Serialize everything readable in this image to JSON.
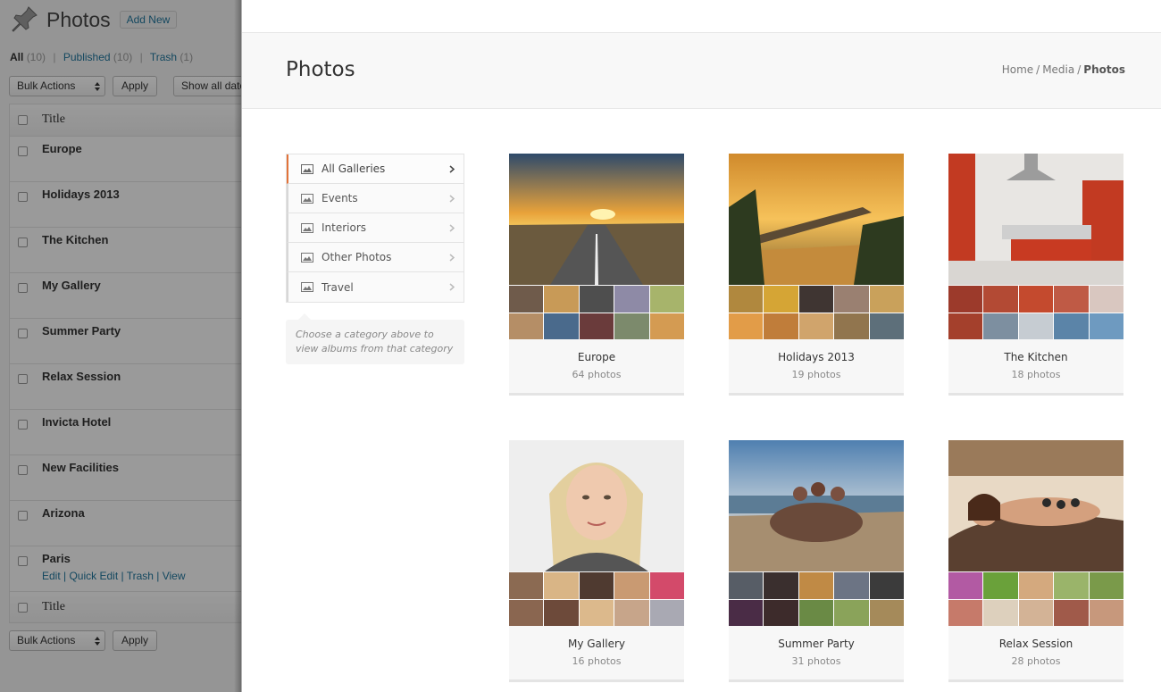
{
  "admin": {
    "title": "Photos",
    "add_new": "Add New",
    "filter": {
      "all_label": "All",
      "all_count": "(10)",
      "published_label": "Published",
      "published_count": "(10)",
      "trash_label": "Trash",
      "trash_count": "(1)"
    },
    "bulk_actions": "Bulk Actions",
    "apply": "Apply",
    "show_all": "Show all dates",
    "column_title": "Title",
    "items": [
      "Europe",
      "Holidays 2013",
      "The Kitchen",
      "My Gallery",
      "Summer Party",
      "Relax Session",
      "Invicta Hotel",
      "New Facilities",
      "Arizona",
      "Paris"
    ],
    "row_actions": "Edit | Quick Edit | Trash | View"
  },
  "page": {
    "title": "Photos",
    "breadcrumb": {
      "home": "Home",
      "media": "Media",
      "current": "Photos",
      "separator": "/"
    }
  },
  "categories": {
    "items": [
      "All Galleries",
      "Events",
      "Interiors",
      "Other Photos",
      "Travel"
    ],
    "note": "Choose a category above to view albums from that category"
  },
  "albums": [
    {
      "name": "Europe",
      "count": "64 photos"
    },
    {
      "name": "Holidays 2013",
      "count": "19 photos"
    },
    {
      "name": "The Kitchen",
      "count": "18 photos"
    },
    {
      "name": "My Gallery",
      "count": "16 photos"
    },
    {
      "name": "Summer Party",
      "count": "31 photos"
    },
    {
      "name": "Relax Session",
      "count": "28 photos"
    }
  ],
  "colors": {
    "accent": "#e2733a",
    "link": "#21759b"
  }
}
